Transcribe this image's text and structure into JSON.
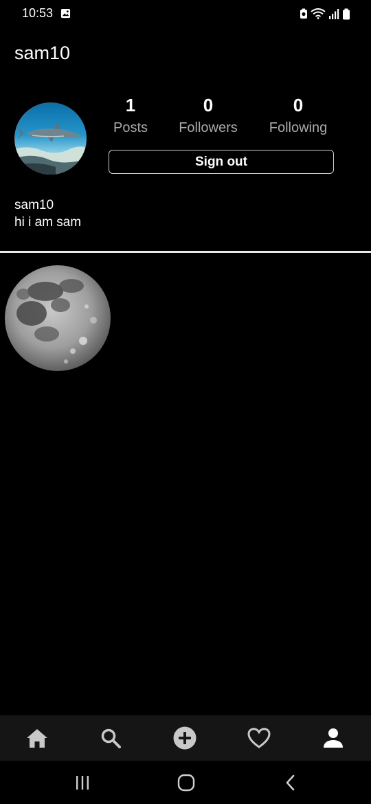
{
  "status_bar": {
    "time": "10:53",
    "left_icons": [
      "image-icon"
    ],
    "right_icons": [
      "battery-saver-icon",
      "wifi-icon",
      "signal-icon",
      "battery-icon"
    ]
  },
  "profile": {
    "username": "sam10",
    "avatar_icon": "shark-photo",
    "stats": {
      "posts": {
        "value": "1",
        "label": "Posts"
      },
      "followers": {
        "value": "0",
        "label": "Followers"
      },
      "following": {
        "value": "0",
        "label": "Following"
      }
    },
    "signout_label": "Sign out",
    "bio_name": "sam10",
    "bio_text": "hi i am sam"
  },
  "posts": [
    {
      "image": "moon-photo"
    }
  ],
  "bottom_nav": {
    "items": [
      {
        "icon": "home-icon"
      },
      {
        "icon": "search-icon"
      },
      {
        "icon": "add-post-icon"
      },
      {
        "icon": "heart-icon"
      },
      {
        "icon": "profile-icon",
        "active": true
      }
    ]
  },
  "system_nav": {
    "items": [
      "recent-apps-icon",
      "home-circle-icon",
      "back-icon"
    ]
  },
  "colors": {
    "background": "#000000",
    "nav_background": "#151515",
    "muted_text": "#a8a8a8",
    "icon_inactive": "#c8c8c8",
    "icon_active": "#ffffff"
  }
}
